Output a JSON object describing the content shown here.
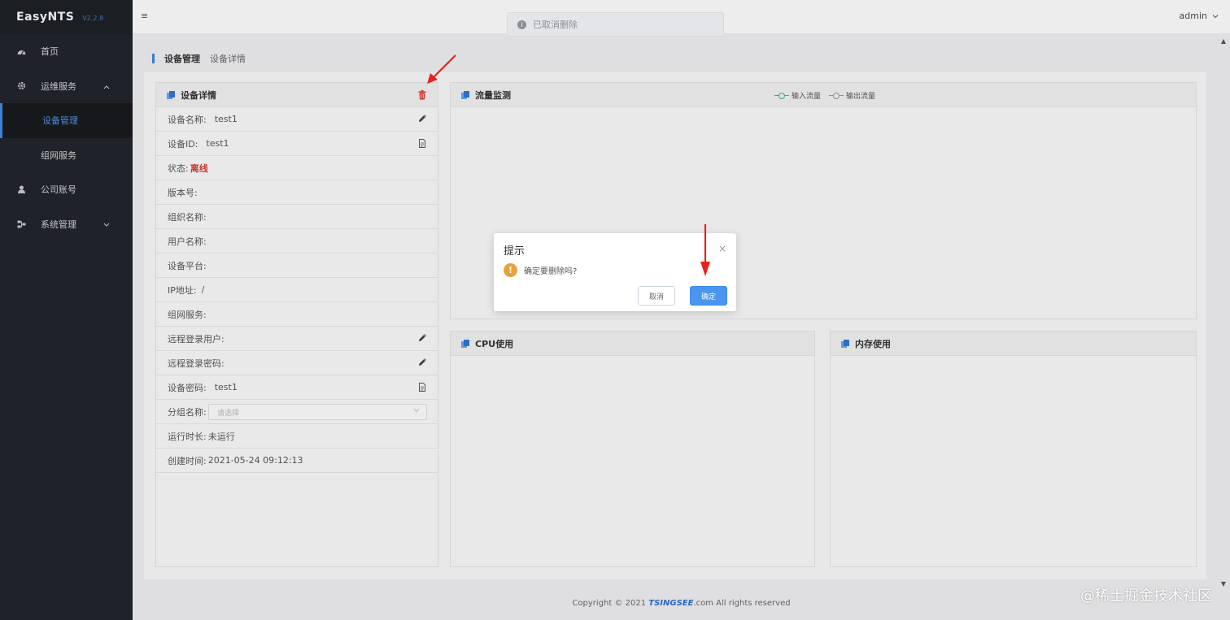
{
  "brand": {
    "name": "EasyNTS",
    "version": "V2.2.8"
  },
  "sidebar": {
    "items": [
      {
        "label": "首页",
        "icon": "dashboard-icon"
      },
      {
        "label": "运维服务",
        "icon": "gear-icon",
        "expanded": true
      },
      {
        "label": "设备管理",
        "sub": true,
        "active": true
      },
      {
        "label": "组网服务",
        "sub": true
      },
      {
        "label": "公司账号",
        "icon": "user-icon"
      },
      {
        "label": "系统管理",
        "icon": "sitemap-icon",
        "expanded": false
      }
    ]
  },
  "header": {
    "menu_icon": "≡",
    "user": "admin"
  },
  "toast": {
    "text": "已取消删除"
  },
  "breadcrumb": {
    "level1": "设备管理",
    "level2": "设备详情"
  },
  "device_panel": {
    "title": "设备详情",
    "rows": [
      {
        "label": "设备名称:",
        "value": "test1",
        "action": "edit-icon"
      },
      {
        "label": "设备ID:",
        "value": "test1",
        "action": "copy-icon"
      },
      {
        "label": "状态:",
        "value": "离线",
        "status": "offline"
      },
      {
        "label": "版本号:",
        "value": ""
      },
      {
        "label": "组织名称:",
        "value": ""
      },
      {
        "label": "用户名称:",
        "value": ""
      },
      {
        "label": "设备平台:",
        "value": ""
      },
      {
        "label": "IP地址:",
        "value": "/"
      },
      {
        "label": "组网服务:",
        "value": ""
      },
      {
        "label": "远程登录用户:",
        "value": "",
        "action": "edit-icon"
      },
      {
        "label": "远程登录密码:",
        "value": "",
        "action": "edit-icon"
      },
      {
        "label": "设备密码:",
        "value": "test1",
        "action": "copy-icon"
      },
      {
        "label": "分组名称:",
        "select_placeholder": "请选择"
      },
      {
        "label": "运行时长:",
        "value": "未运行"
      },
      {
        "label": "创建时间:",
        "value": "2021-05-24 09:12:13"
      }
    ]
  },
  "traffic_panel": {
    "title": "流量监测",
    "legend": [
      {
        "name": "输入流量",
        "color": "#3cb371"
      },
      {
        "name": "输出流量",
        "color": "#8a9aa8"
      }
    ]
  },
  "cpu_panel": {
    "title": "CPU使用"
  },
  "memory_panel": {
    "title": "内存使用"
  },
  "dialog": {
    "title": "提示",
    "message": "确定要删除吗?",
    "cancel": "取消",
    "confirm": "确定",
    "close": "×"
  },
  "footer": {
    "prefix": "Copyright © 2021 ",
    "brand": "TSINGSEE",
    "suffix": ".com All rights reserved"
  },
  "watermark": "@稀土掘金技术社区",
  "colors": {
    "accent": "#3b82d6",
    "danger": "#d23a2e",
    "warning": "#e6a23c",
    "sidebar_bg": "#1f2329"
  }
}
